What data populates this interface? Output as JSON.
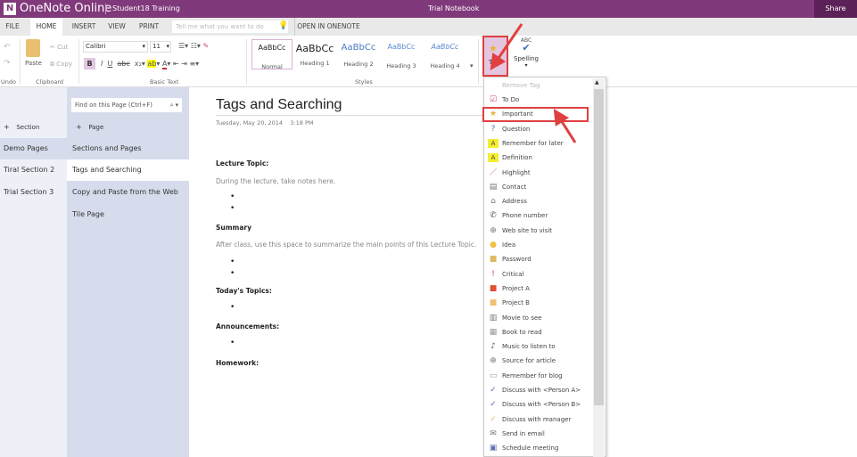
{
  "titlebar": {
    "app": "OneNote Online",
    "account": "Student18 Training",
    "notebook": "Trial Notebook",
    "share": "Share"
  },
  "tabs": [
    "FILE",
    "HOME",
    "INSERT",
    "VIEW",
    "PRINT"
  ],
  "tell_me": "Tell me what you want to do",
  "open_in": "OPEN IN ONENOTE",
  "ribbon": {
    "undo_group": "Undo",
    "paste": "Paste",
    "cut": "Cut",
    "copy": "Copy",
    "clipboard_group": "Clipboard",
    "font": "Calibri",
    "size": "11",
    "basic_text_group": "Basic Text",
    "styles": [
      {
        "sample": "AaBbCc",
        "label": "Normal"
      },
      {
        "sample": "AaBbCc",
        "label": "Heading 1"
      },
      {
        "sample": "AaBbCc",
        "label": "Heading 2"
      },
      {
        "sample": "AaBbCc",
        "label": "Heading 3"
      },
      {
        "sample": "AaBbCc",
        "label": "Heading 4"
      }
    ],
    "styles_group": "Styles",
    "tag": "Tag",
    "spelling_abc": "ABC",
    "spelling": "Spelling"
  },
  "sections": {
    "add": "Section",
    "items": [
      "Demo Pages",
      "Tiral Section 2",
      "Trial Section 3"
    ],
    "selected": "Demo Pages"
  },
  "pages": {
    "find_placeholder": "Find on this Page (Ctrl+F)",
    "add": "Page",
    "items": [
      "Sections and Pages",
      "Tags and Searching",
      "Copy and Paste from the Web",
      "Tile Page"
    ],
    "selected": "Tags and Searching"
  },
  "page": {
    "title": "Tags and Searching",
    "date": "Tuesday, May 20, 2014",
    "time": "3:18 PM",
    "lecture_heading": "Lecture Topic:",
    "lecture_text": "During the lecture, take notes here.",
    "summary_heading": "Summary",
    "summary_text": "After class, use this space to summarize the main points of this Lecture Topic.",
    "topics_heading": "Today's Topics:",
    "announcements_heading": "Announcements:",
    "homework_heading": "Homework:"
  },
  "tag_menu": {
    "remove": "Remove Tag",
    "highlighted": "Important",
    "items": [
      {
        "label": "To Do",
        "icon": "checkbox-icon",
        "color": "#d04a6a"
      },
      {
        "label": "Important",
        "icon": "star-icon",
        "color": "#e8b53a"
      },
      {
        "label": "Question",
        "icon": "question-icon",
        "color": "#5a6fb0"
      },
      {
        "label": "Remember for later",
        "icon": "highlight-a-icon",
        "color": "#d8c400"
      },
      {
        "label": "Definition",
        "icon": "highlight-a-icon",
        "color": "#d8c400"
      },
      {
        "label": "Highlight",
        "icon": "pen-icon",
        "color": "#c05050"
      },
      {
        "label": "Contact",
        "icon": "contact-card-icon",
        "color": "#777"
      },
      {
        "label": "Address",
        "icon": "house-icon",
        "color": "#777"
      },
      {
        "label": "Phone number",
        "icon": "phone-icon",
        "color": "#555"
      },
      {
        "label": "Web site to visit",
        "icon": "globe-icon",
        "color": "#777"
      },
      {
        "label": "Idea",
        "icon": "lightbulb-icon",
        "color": "#f0c040"
      },
      {
        "label": "Password",
        "icon": "lock-icon",
        "color": "#e0b860"
      },
      {
        "label": "Critical",
        "icon": "exclamation-icon",
        "color": "#e03030"
      },
      {
        "label": "Project A",
        "icon": "square-icon",
        "color": "#e05030"
      },
      {
        "label": "Project B",
        "icon": "square-icon",
        "color": "#f0c070"
      },
      {
        "label": "Movie to see",
        "icon": "film-icon",
        "color": "#777"
      },
      {
        "label": "Book to read",
        "icon": "book-icon",
        "color": "#999"
      },
      {
        "label": "Music to listen to",
        "icon": "music-note-icon",
        "color": "#555"
      },
      {
        "label": "Source for article",
        "icon": "globe-icon",
        "color": "#777"
      },
      {
        "label": "Remember for blog",
        "icon": "speech-bubble-icon",
        "color": "#999"
      },
      {
        "label": "Discuss with <Person A>",
        "icon": "discuss-icon",
        "color": "#5a6fb0"
      },
      {
        "label": "Discuss with <Person B>",
        "icon": "discuss-icon",
        "color": "#5a6fb0"
      },
      {
        "label": "Discuss with manager",
        "icon": "discuss-icon",
        "color": "#e0b860"
      },
      {
        "label": "Send in email",
        "icon": "email-icon",
        "color": "#777"
      },
      {
        "label": "Schedule meeting",
        "icon": "calendar-icon",
        "color": "#5a6fb0"
      }
    ]
  },
  "colors": {
    "brand": "#80397b",
    "share": "#5c2157",
    "annotation": "#e04040"
  }
}
